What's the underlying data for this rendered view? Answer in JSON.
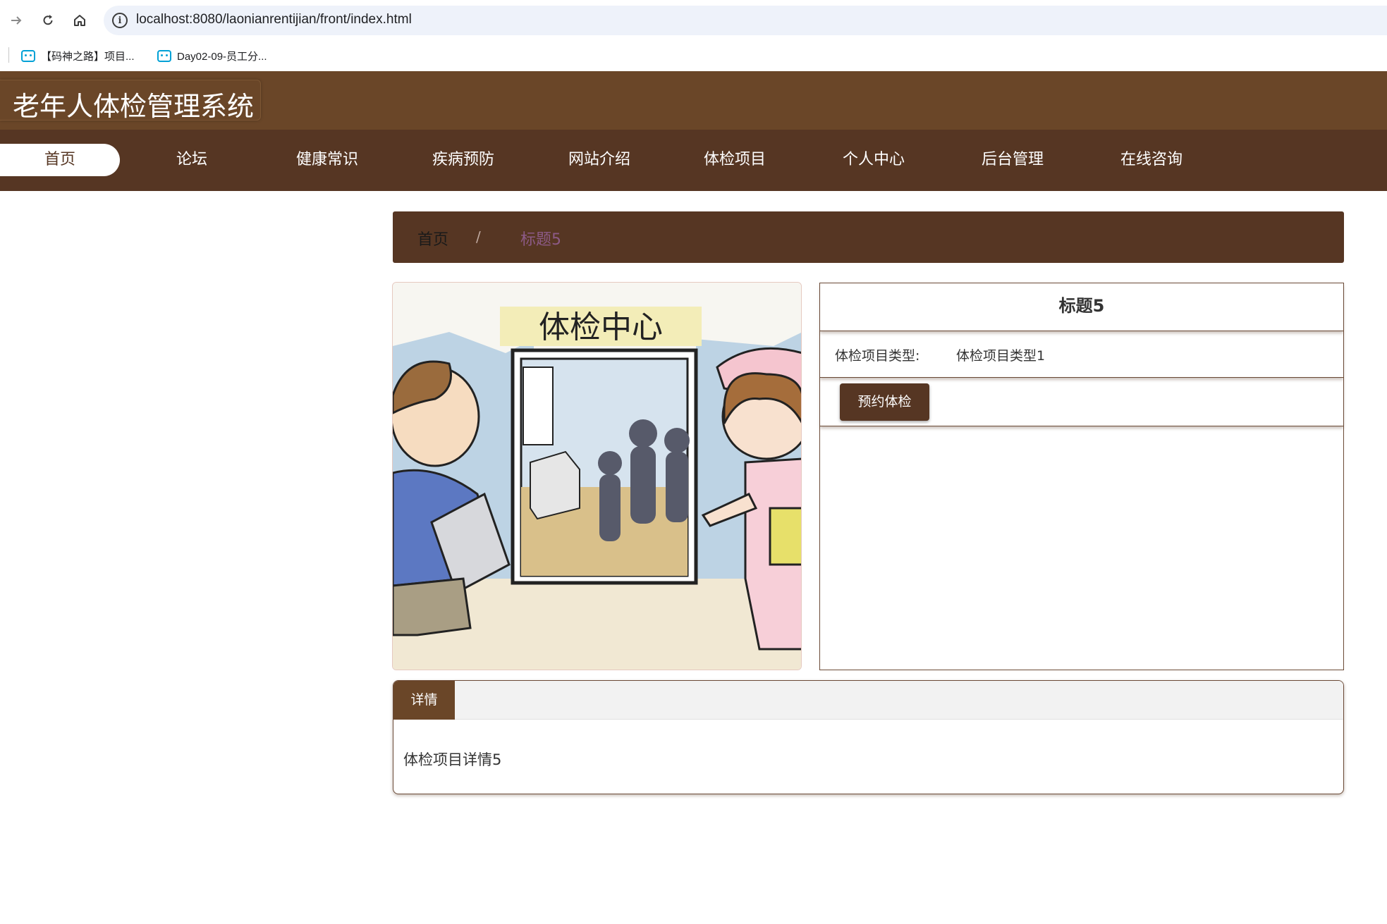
{
  "browser": {
    "url": "localhost:8080/laonianrentijian/front/index.html",
    "bookmarks": [
      {
        "label": "【码神之路】项目..."
      },
      {
        "label": "Day02-09-员工分..."
      }
    ]
  },
  "site": {
    "title": "老年人体检管理系统"
  },
  "nav": {
    "items": [
      {
        "label": "首页"
      },
      {
        "label": "论坛"
      },
      {
        "label": "健康常识"
      },
      {
        "label": "疾病预防"
      },
      {
        "label": "网站介绍"
      },
      {
        "label": "体检项目"
      },
      {
        "label": "个人中心"
      },
      {
        "label": "后台管理"
      },
      {
        "label": "在线咨询"
      }
    ],
    "active_index": 0
  },
  "breadcrumb": {
    "home": "首页",
    "separator": "/",
    "current": "标题5"
  },
  "image": {
    "sign_text": "体检中心"
  },
  "detail": {
    "title": "标题5",
    "type_label": "体检项目类型:",
    "type_value": "体检项目类型1",
    "book_button": "预约体检"
  },
  "details_panel": {
    "tab_label": "详情",
    "content": "体检项目详情5"
  },
  "colors": {
    "header_brown": "#6a4628",
    "nav_brown": "#563623",
    "crumb_current": "#8c5a86"
  }
}
